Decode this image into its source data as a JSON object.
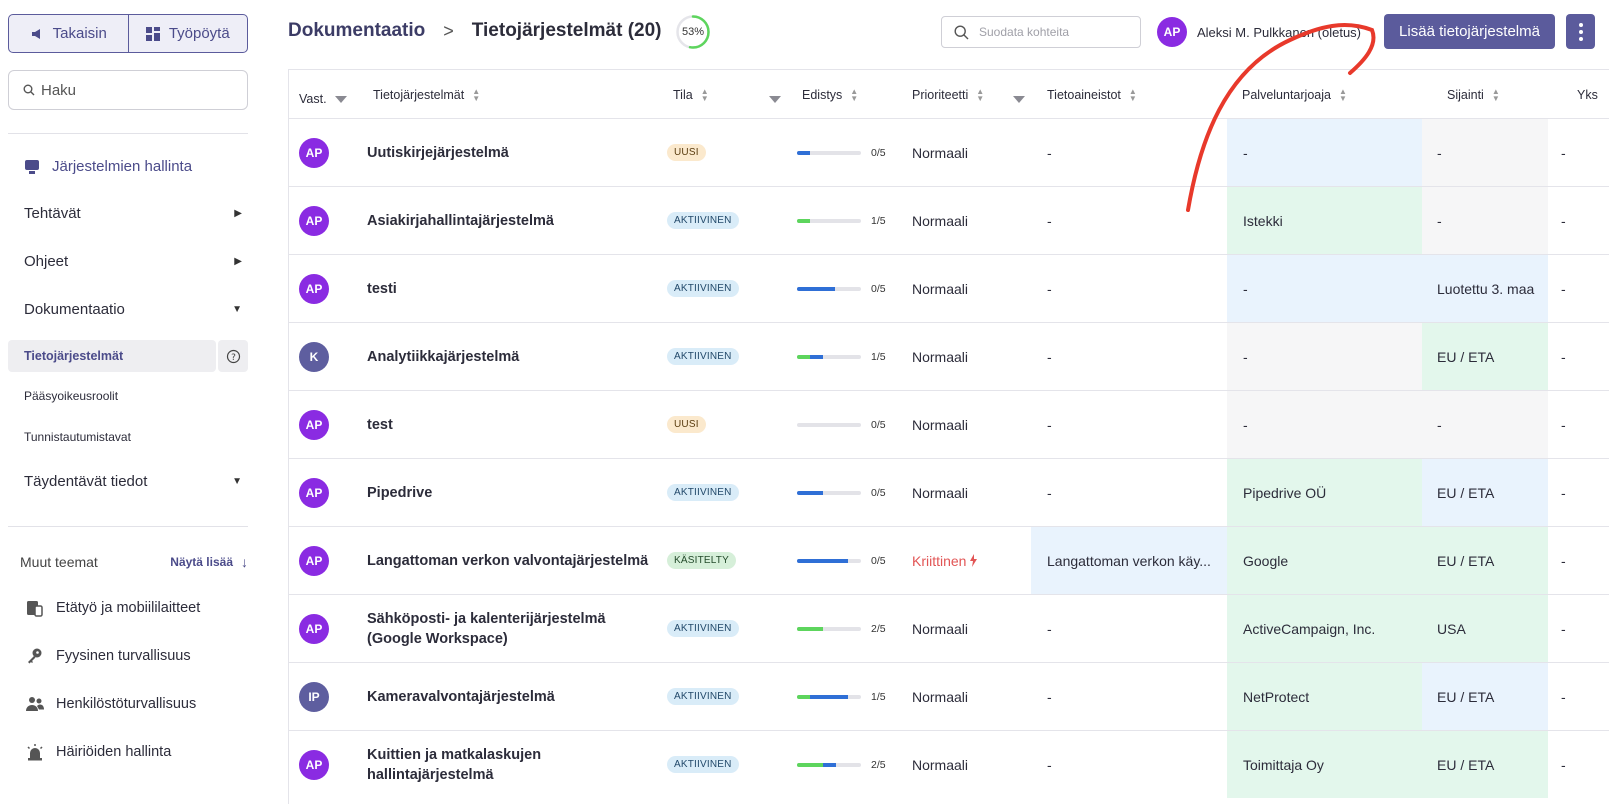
{
  "nav": {
    "back_label": "Takaisin",
    "desktop_label": "Työpöytä",
    "search_placeholder": "Haku"
  },
  "sidebar": {
    "main_label": "Järjestelmien hallinta",
    "items": [
      {
        "label": "Tehtävät",
        "expanded": false
      },
      {
        "label": "Ohjeet",
        "expanded": false
      },
      {
        "label": "Dokumentaatio",
        "expanded": true
      }
    ],
    "subitems": [
      {
        "label": "Tietojärjestelmät",
        "active": true
      },
      {
        "label": "Pääsyoikeusroolit",
        "active": false
      },
      {
        "label": "Tunnistautumistavat",
        "active": false
      }
    ],
    "extra_item": {
      "label": "Täydentävät tiedot",
      "expanded": true
    },
    "other_themes": {
      "title": "Muut teemat",
      "more_label": "Näytä lisää",
      "items": [
        {
          "label": "Etätyö ja mobiililaitteet",
          "icon": "mobile-devices-icon"
        },
        {
          "label": "Fyysinen turvallisuus",
          "icon": "key-icon"
        },
        {
          "label": "Henkilöstöturvallisuus",
          "icon": "people-icon"
        },
        {
          "label": "Häiriöiden hallinta",
          "icon": "alarm-icon"
        }
      ]
    }
  },
  "header": {
    "breadcrumb_parent": "Dokumentaatio",
    "breadcrumb_current": "Tietojärjestelmät (20)",
    "progress_text": "53%",
    "progress_value": 53,
    "filter_placeholder": "Suodata kohteita",
    "user_initials": "AP",
    "user_name": "Aleksi M. Pulkkanen (oletus)",
    "add_button": "Lisää tietojärjestelmä"
  },
  "colors": {
    "accent": "#5b5b9c",
    "avatar_purple": "#8a2be2",
    "avatar_slate": "#5e5e9f",
    "progress_green": "#5dd55d",
    "progress_blue": "#2f6fd6",
    "critical": "#e25555",
    "annotation_red": "#e8392b"
  },
  "table": {
    "columns": [
      "Vast.",
      "Tietojärjestelmät",
      "Tila",
      "Edistys",
      "Prioriteetti",
      "Tietoaineistot",
      "Palveluntarjoaja",
      "Sijainti",
      "Yks"
    ],
    "rows": [
      {
        "owner": "AP",
        "owner_color": "purple",
        "name": "Uutiskirjejärjestelmä",
        "status": "UUSI",
        "status_type": "new",
        "green": 0,
        "blue": 0.2,
        "progress_text": "0/5",
        "priority": "Normaali",
        "critical": false,
        "data": "-",
        "data_bg": "",
        "provider": "-",
        "provider_bg": "blue",
        "location": "-",
        "location_bg": "gray",
        "unit": "-"
      },
      {
        "owner": "AP",
        "owner_color": "purple",
        "name": "Asiakirjahallintajärjestelmä",
        "status": "AKTIIVINEN",
        "status_type": "active",
        "green": 0.2,
        "blue": 0,
        "progress_text": "1/5",
        "priority": "Normaali",
        "critical": false,
        "data": "-",
        "data_bg": "",
        "provider": "Istekki",
        "provider_bg": "green",
        "location": "-",
        "location_bg": "gray",
        "unit": "-"
      },
      {
        "owner": "AP",
        "owner_color": "purple",
        "name": "testi",
        "status": "AKTIIVINEN",
        "status_type": "active",
        "green": 0,
        "blue": 0.6,
        "progress_text": "0/5",
        "priority": "Normaali",
        "critical": false,
        "data": "-",
        "data_bg": "",
        "provider": "-",
        "provider_bg": "blue",
        "location": "Luotettu 3. maa",
        "location_bg": "blue",
        "unit": "-"
      },
      {
        "owner": "K",
        "owner_color": "slate",
        "name": "Analytiikkajärjestelmä",
        "status": "AKTIIVINEN",
        "status_type": "active",
        "green": 0.2,
        "blue": 0.2,
        "progress_text": "1/5",
        "priority": "Normaali",
        "critical": false,
        "data": "-",
        "data_bg": "",
        "provider": "-",
        "provider_bg": "gray",
        "location": "EU / ETA",
        "location_bg": "green",
        "unit": "-"
      },
      {
        "owner": "AP",
        "owner_color": "purple",
        "name": "test",
        "status": "UUSI",
        "status_type": "new",
        "green": 0,
        "blue": 0,
        "progress_text": "0/5",
        "priority": "Normaali",
        "critical": false,
        "data": "-",
        "data_bg": "",
        "provider": "-",
        "provider_bg": "gray",
        "location": "-",
        "location_bg": "gray",
        "unit": "-"
      },
      {
        "owner": "AP",
        "owner_color": "purple",
        "name": "Pipedrive",
        "status": "AKTIIVINEN",
        "status_type": "active",
        "green": 0,
        "blue": 0.4,
        "progress_text": "0/5",
        "priority": "Normaali",
        "critical": false,
        "data": "-",
        "data_bg": "",
        "provider": "Pipedrive OÜ",
        "provider_bg": "green",
        "location": "EU / ETA",
        "location_bg": "blue",
        "unit": "-"
      },
      {
        "owner": "AP",
        "owner_color": "purple",
        "name": "Langattoman verkon valvontajärjestelmä",
        "status": "KÄSITELTY",
        "status_type": "done",
        "green": 0,
        "blue": 0.8,
        "progress_text": "0/5",
        "priority": "Kriittinen",
        "critical": true,
        "data": "Langattoman verkon käy...",
        "data_bg": "blue",
        "provider": "Google",
        "provider_bg": "green",
        "location": "EU / ETA",
        "location_bg": "green",
        "unit": "-"
      },
      {
        "owner": "AP",
        "owner_color": "purple",
        "name": "Sähköposti- ja kalenterijärjestelmä (Google Workspace)",
        "status": "AKTIIVINEN",
        "status_type": "active",
        "green": 0.4,
        "blue": 0,
        "progress_text": "2/5",
        "priority": "Normaali",
        "critical": false,
        "data": "-",
        "data_bg": "",
        "provider": "ActiveCampaign, Inc.",
        "provider_bg": "green",
        "location": "USA",
        "location_bg": "green",
        "unit": "-"
      },
      {
        "owner": "IP",
        "owner_color": "slate",
        "name": "Kameravalvontajärjestelmä",
        "status": "AKTIIVINEN",
        "status_type": "active",
        "green": 0.2,
        "blue": 0.6,
        "progress_text": "1/5",
        "priority": "Normaali",
        "critical": false,
        "data": "-",
        "data_bg": "",
        "provider": "NetProtect",
        "provider_bg": "green",
        "location": "EU / ETA",
        "location_bg": "blue",
        "unit": "-"
      },
      {
        "owner": "AP",
        "owner_color": "purple",
        "name": "Kuittien ja matkalaskujen hallintajärjestelmä",
        "status": "AKTIIVINEN",
        "status_type": "active",
        "green": 0.4,
        "blue": 0.2,
        "progress_text": "2/5",
        "priority": "Normaali",
        "critical": false,
        "data": "-",
        "data_bg": "",
        "provider": "Toimittaja Oy",
        "provider_bg": "green",
        "location": "EU / ETA",
        "location_bg": "green",
        "unit": "-"
      }
    ]
  }
}
